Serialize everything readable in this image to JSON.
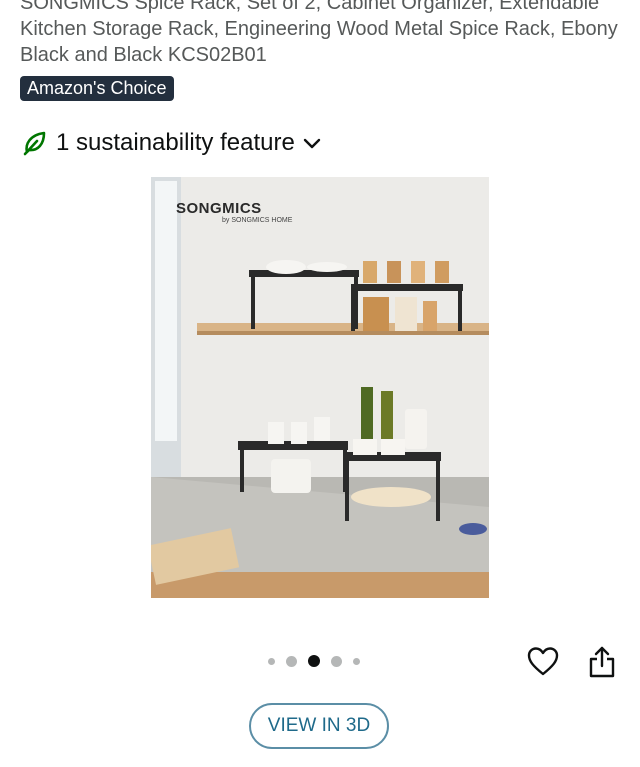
{
  "product": {
    "title": "SONGMICS Spice Rack, Set of 2, Cabinet Organizer, Extendable Kitchen Storage Rack, Engineering Wood Metal Spice Rack, Ebony Black and Black KCS02B01",
    "badge": "Amazon's Choice"
  },
  "sustainability": {
    "label": "1 sustainability feature",
    "icon": "leaf-icon",
    "accent": "#007600"
  },
  "image": {
    "brand": "SONGMICS",
    "brand_sub": "by SONGMICS HOME"
  },
  "carousel": {
    "total": 5,
    "active_index": 2
  },
  "actions": {
    "wishlist_icon": "heart-icon",
    "share_icon": "share-icon",
    "view_3d_label": "VIEW IN 3D"
  }
}
